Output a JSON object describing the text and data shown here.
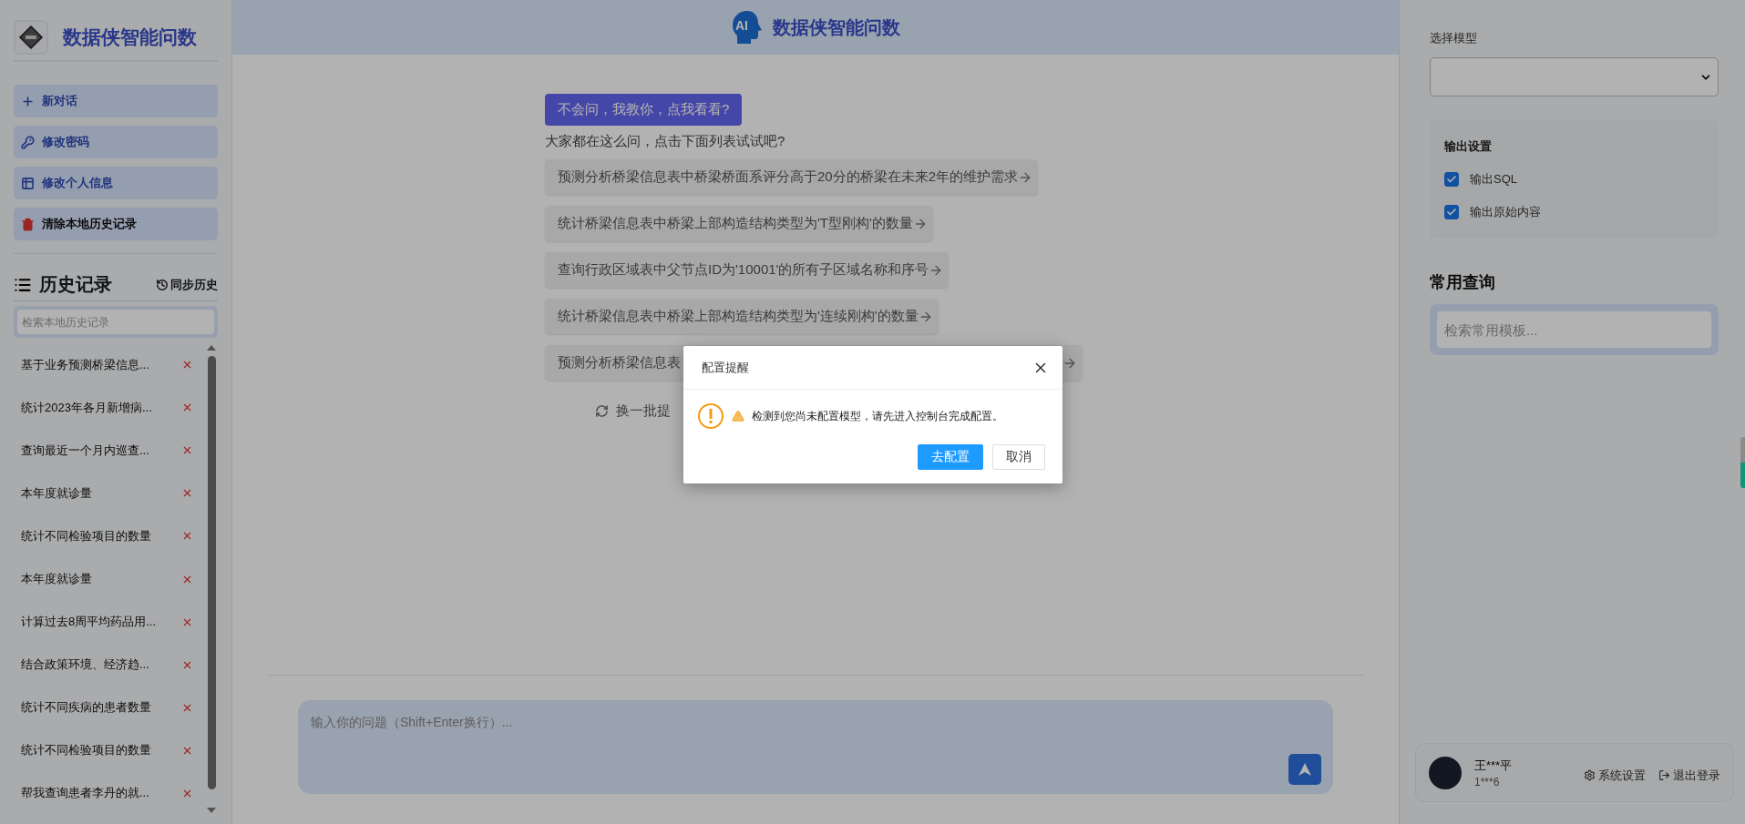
{
  "sidebar": {
    "title": "数据侠智能问数",
    "actions": [
      {
        "label": "新对话",
        "kind": "new"
      },
      {
        "label": "修改密码",
        "kind": "password"
      },
      {
        "label": "修改个人信息",
        "kind": "profile"
      },
      {
        "label": "清除本地历史记录",
        "kind": "clear"
      }
    ],
    "history": {
      "title": "历史记录",
      "sync": "同步历史",
      "placeholder": "检索本地历史记录",
      "items": [
        {
          "text": "基于业务预测桥梁信息..."
        },
        {
          "text": "统计2023年各月新增病..."
        },
        {
          "text": "查询最近一个月内巡查..."
        },
        {
          "text": "本年度就诊量"
        },
        {
          "text": "统计不同检验项目的数量"
        },
        {
          "text": "本年度就诊量"
        },
        {
          "text": "计算过去8周平均药品用..."
        },
        {
          "text": "结合政策环境、经济趋..."
        },
        {
          "text": "统计不同疾病的患者数量"
        },
        {
          "text": "统计不同检验项目的数量"
        },
        {
          "text": "帮我查询患者李丹的就..."
        }
      ]
    }
  },
  "header": {
    "logo_text": "AI",
    "title": "数据侠智能问数"
  },
  "chat": {
    "teach_button": "不会问，我教你，点我看看?",
    "prompt": "大家都在这么问，点击下面列表试试吧?",
    "suggestions": [
      "预测分析桥梁信息表中桥梁桥面系评分高于20分的桥梁在未来2年的维护需求",
      "统计桥梁信息表中桥梁上部构造结构类型为'T型刚构'的数量",
      "查询行政区域表中父节点ID为'10001'的所有子区域名称和序号",
      "统计桥梁信息表中桥梁上部构造结构类型为'连续刚构'的数量",
      "预测分析桥梁信息表"
    ],
    "refresh": "换一批提",
    "input_placeholder": "输入你的问题（Shift+Enter换行）..."
  },
  "settings": {
    "model_label": "选择模型",
    "output": {
      "title": "输出设置",
      "options": [
        {
          "label": "输出SQL",
          "checked": true
        },
        {
          "label": "输出原始内容",
          "checked": true
        }
      ]
    },
    "common_title": "常用查询",
    "common_placeholder": "检索常用模板..."
  },
  "user": {
    "name": "王***平",
    "id": "1***6",
    "settings": "系统设置",
    "logout": "退出登录"
  },
  "dialog": {
    "title": "配置提醒",
    "message": "检测到您尚未配置模型，请先进入控制台完成配置。",
    "confirm": "去配置",
    "cancel": "取消"
  }
}
